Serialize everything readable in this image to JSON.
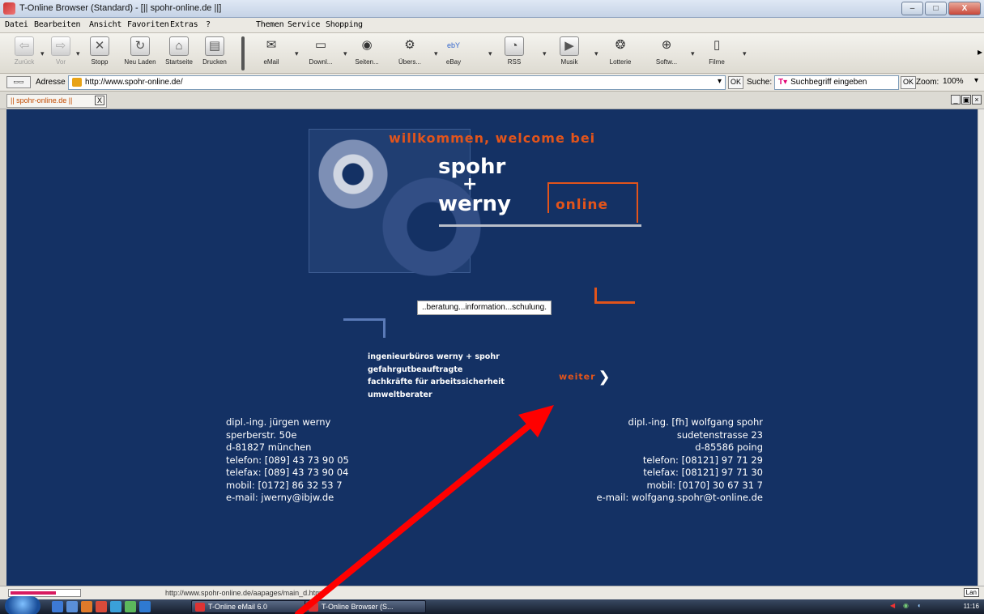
{
  "window": {
    "title": "T-Online Browser (Standard) - [|| spohr-online.de ||]",
    "buttons": [
      "–",
      "□",
      "X"
    ]
  },
  "menu": {
    "left": [
      "Datei",
      "Bearbeiten",
      "Ansicht",
      "Favoriten",
      "Extras",
      "?"
    ],
    "right": [
      "Themen",
      "Service",
      "Shopping"
    ]
  },
  "toolbar": {
    "buttons": [
      {
        "label": "Zurück",
        "icon": "back-icon"
      },
      {
        "label": "Vor",
        "icon": "forward-icon"
      },
      {
        "label": "Stopp",
        "icon": "stop-icon"
      },
      {
        "label": "Neu Laden",
        "icon": "reload-icon"
      },
      {
        "label": "Startseite",
        "icon": "home-icon"
      },
      {
        "label": "Drucken",
        "icon": "print-icon"
      }
    ],
    "services": [
      {
        "label": "eMail",
        "icon": "mail-icon"
      },
      {
        "label": "Downl...",
        "icon": "download-icon"
      },
      {
        "label": "Seiten...",
        "icon": "pages-icon"
      },
      {
        "label": "Übers...",
        "icon": "translate-icon"
      },
      {
        "label": "eBay",
        "icon": "ebay-icon"
      },
      {
        "label": "RSS",
        "icon": "rss-icon"
      },
      {
        "label": "Musik",
        "icon": "music-icon"
      },
      {
        "label": "Lotterie",
        "icon": "lottery-icon"
      },
      {
        "label": "Softw...",
        "icon": "software-icon"
      },
      {
        "label": "Filme",
        "icon": "film-icon"
      }
    ]
  },
  "address": {
    "label": "Adresse",
    "url": "http://www.spohr-online.de/",
    "ok": "OK",
    "search_label": "Suche:",
    "search_placeholder": "Suchbegriff eingeben",
    "zoom_label": "Zoom:",
    "zoom_value": "100%"
  },
  "tab": {
    "title": "|| spohr-online.de ||",
    "close": "X"
  },
  "page": {
    "welcome": "willkommen, welcome bei",
    "brand_spohr": "spohr",
    "brand_plus": "+",
    "brand_werny": "werny",
    "brand_online": "online",
    "tagline": "..beratung...information...schulung.",
    "services": [
      "ingenieurbüros werny + spohr",
      "gefahrgutbeauftragte",
      "fachkräfte für arbeitssicherheit",
      "umweltberater"
    ],
    "weiter": "weiter",
    "contact_left": [
      "dipl.-ing. jürgen werny",
      "sperberstr. 50e",
      "d-81827 münchen",
      "telefon:  [089]  43 73 90 05",
      "telefax:  [089]  43 73 90 04",
      "mobil:  [0172]  86 32 53 7",
      "e-mail:  jwerny@ibjw.de"
    ],
    "contact_right": [
      "dipl.-ing. [fh] wolfgang spohr",
      "sudetenstrasse 23",
      "d-85586 poing",
      "telefon:  [08121]  97 71 29",
      "telefax:  [08121]  97 71 30",
      "mobil:  [0170]  30 67 31 7",
      "e-mail:  wolfgang.spohr@t-online.de"
    ]
  },
  "status": {
    "url": "http://www.spohr-online.de/aapages/main_d.htm",
    "right": "Lan",
    "progress_fraction": 0.65
  },
  "taskbar": {
    "items": [
      "T-Online eMail 6.0",
      "T-Online Browser (S..."
    ],
    "clock": "11:16"
  },
  "colors": {
    "page_bg": "#143164",
    "accent_orange": "#e2541b",
    "annotation_arrow": "#ff0000"
  }
}
